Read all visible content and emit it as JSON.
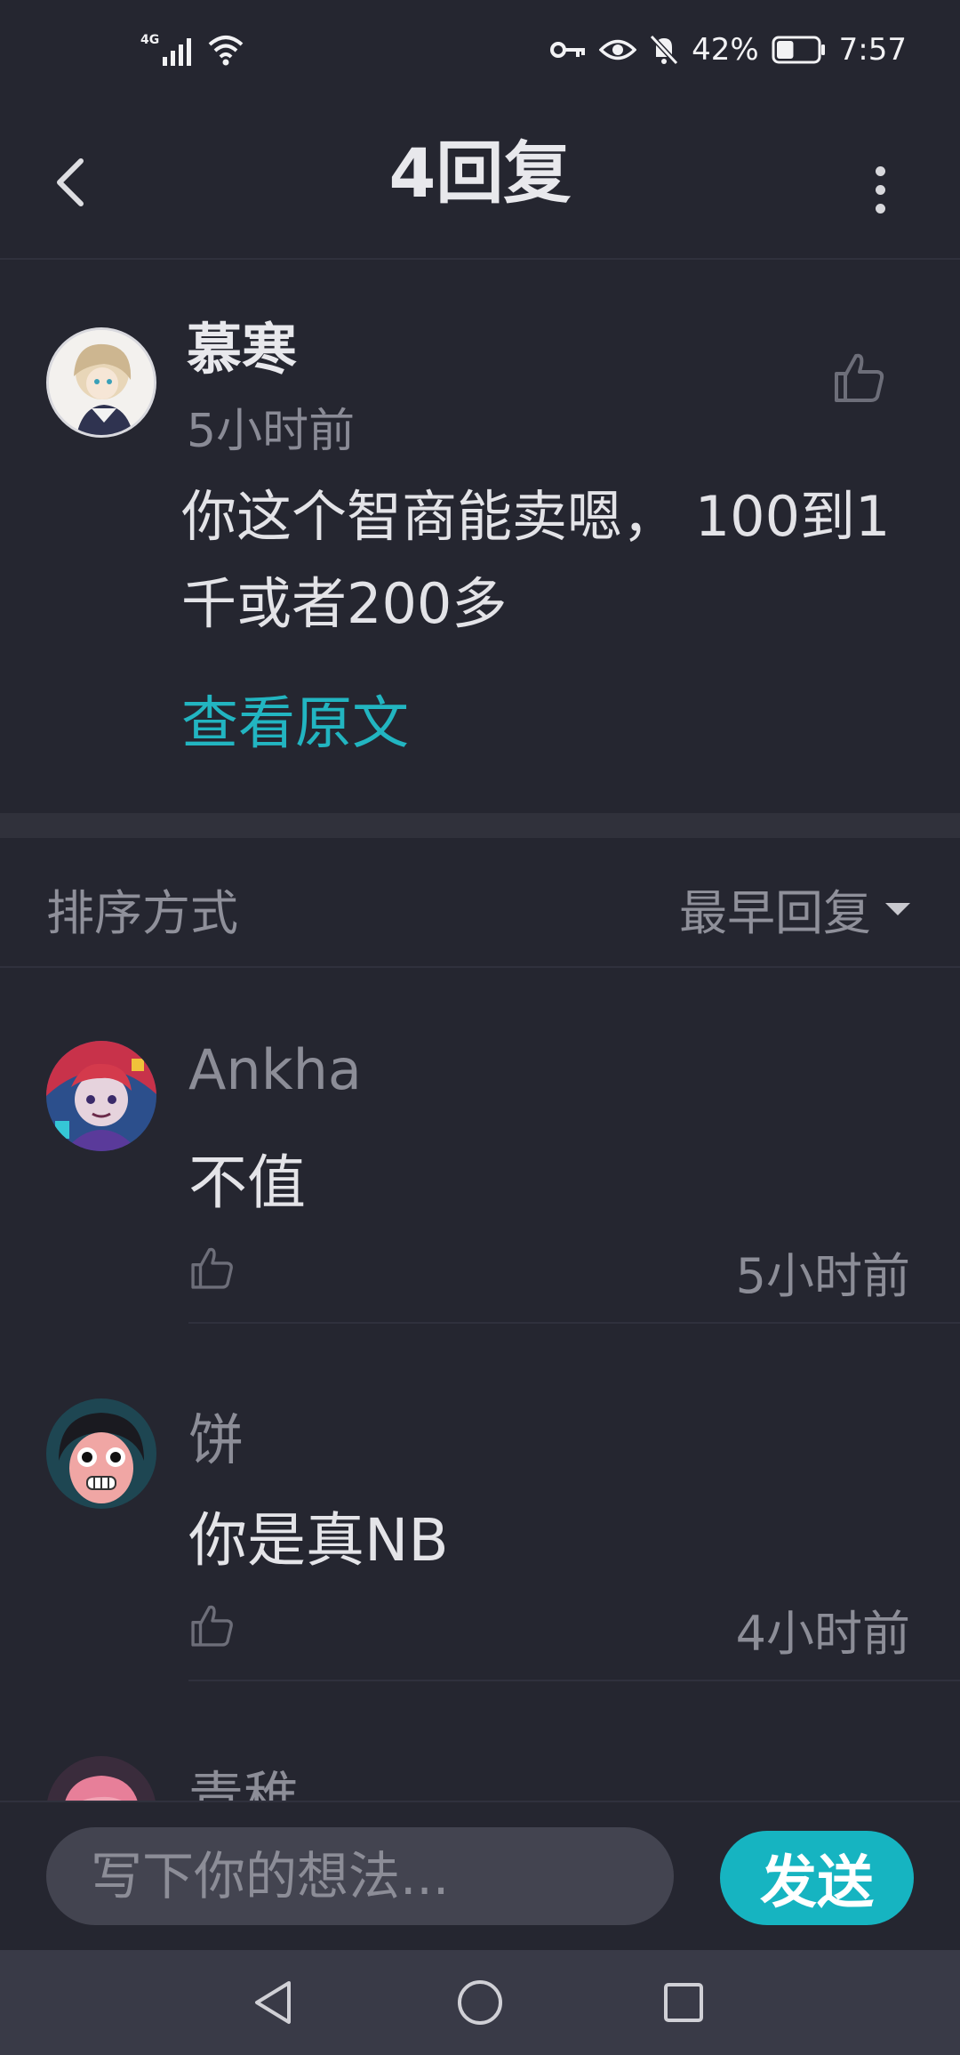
{
  "status_bar": {
    "network": "4G",
    "battery_percent": "42%",
    "battery_level": 0.42,
    "time": "7:57",
    "icons": [
      "signal-icon",
      "wifi-icon",
      "vpn-key-icon",
      "eye-icon",
      "bell-muted-icon",
      "battery-icon"
    ]
  },
  "header": {
    "title": "4回复",
    "icons": [
      "back-arrow-icon",
      "more-vertical-icon"
    ]
  },
  "main_comment": {
    "author": "慕寒",
    "time": "5小时前",
    "text": "你这个智商能卖嗯， 100到1千或者200多",
    "view_original": "查看原文",
    "like_icon": "thumbs-up-icon"
  },
  "sort": {
    "label": "排序方式",
    "selected": "最早回复"
  },
  "replies": [
    {
      "author": "Ankha",
      "text": "不值",
      "time": "5小时前"
    },
    {
      "author": "饼",
      "text": "你是真NB",
      "time": "4小时前"
    },
    {
      "author": "青稚",
      "text": "",
      "time": ""
    }
  ],
  "composer": {
    "placeholder": "写下你的想法...",
    "send_label": "发送"
  },
  "nav": {
    "icons": [
      "nav-back-icon",
      "nav-home-icon",
      "nav-recents-icon"
    ]
  },
  "colors": {
    "background": "#252630",
    "accent": "#16b4c1",
    "link": "#22b5c1",
    "secondary_text": "#8c8d97"
  }
}
